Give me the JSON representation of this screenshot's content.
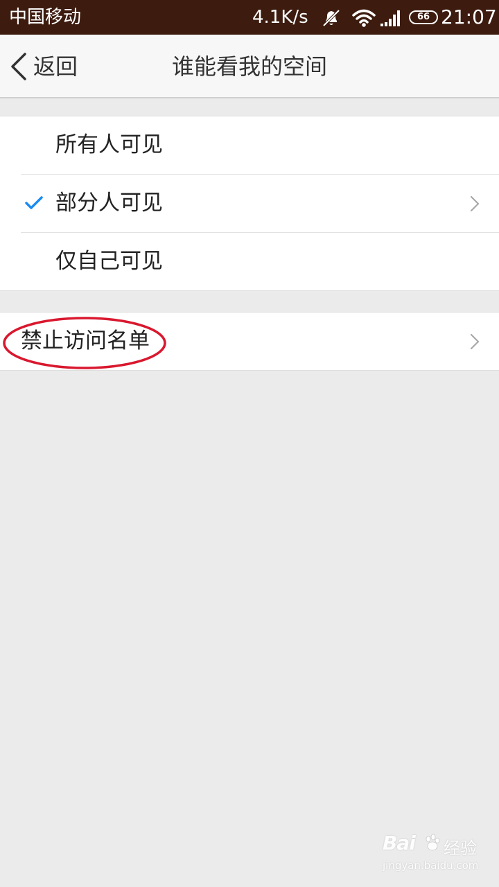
{
  "status_bar": {
    "carrier": "中国移动",
    "network_speed": "4.1K/s",
    "battery_level": "66",
    "time": "21:07",
    "icons": [
      "mute-icon",
      "wifi-icon",
      "signal-icon",
      "battery-icon"
    ]
  },
  "header": {
    "back_label": "返回",
    "title": "谁能看我的空间"
  },
  "visibility_options": [
    {
      "label": "所有人可见",
      "selected": false,
      "has_chevron": false
    },
    {
      "label": "部分人可见",
      "selected": true,
      "has_chevron": true
    },
    {
      "label": "仅自己可见",
      "selected": false,
      "has_chevron": false
    }
  ],
  "block_list": {
    "label": "禁止访问名单",
    "has_chevron": true,
    "highlighted": true
  },
  "colors": {
    "status_bar_bg": "#3d1c0f",
    "check_accent": "#1a8cf0",
    "highlight_oval": "#d9182e",
    "page_bg": "#ebebeb"
  },
  "watermark": {
    "logo_text": "Bai",
    "suffix": "经验",
    "url": "jingyan.baidu.com"
  }
}
